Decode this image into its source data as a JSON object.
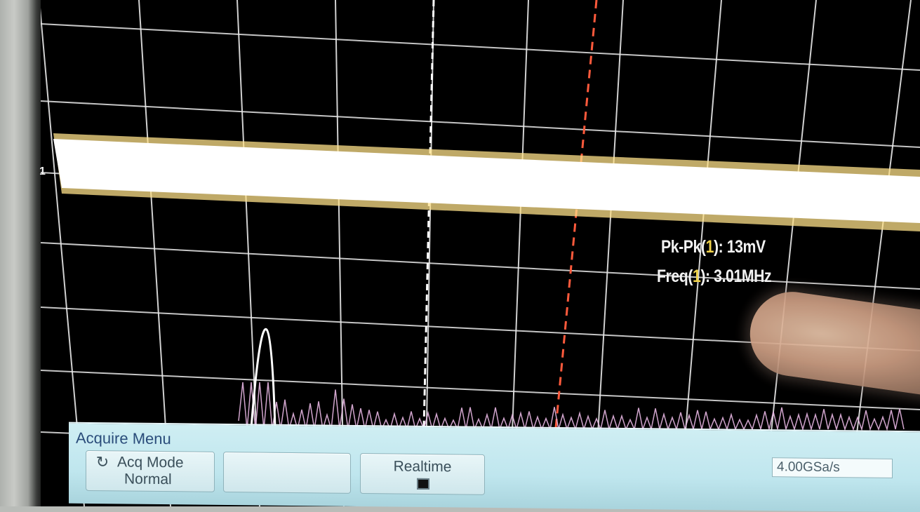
{
  "scope": {
    "channel_marker": "1",
    "measurements": {
      "pkpk_prefix": "Pk-Pk(",
      "pkpk_channel": "1",
      "pkpk_suffix": "): 13mV",
      "freq_prefix": "Freq(",
      "freq_channel": "1",
      "freq_suffix": "): 3.01MHz"
    },
    "colors": {
      "trace": "#ffffff",
      "trace_noise": "#ffe18a",
      "grid": "#e8e8e8",
      "marker_white": "#ffffff",
      "marker_red": "#ff5a3c",
      "spectrum": "#e7b6e2",
      "menu_bg": "#c4e8ef",
      "menu_title": "#2a4c7a"
    }
  },
  "menu": {
    "title": "Acquire Menu",
    "acq_mode_label": "Acq Mode",
    "acq_mode_value": "Normal",
    "realtime_label": "Realtime",
    "realtime_checked": true,
    "sample_rate": "4.00GSa/s"
  }
}
